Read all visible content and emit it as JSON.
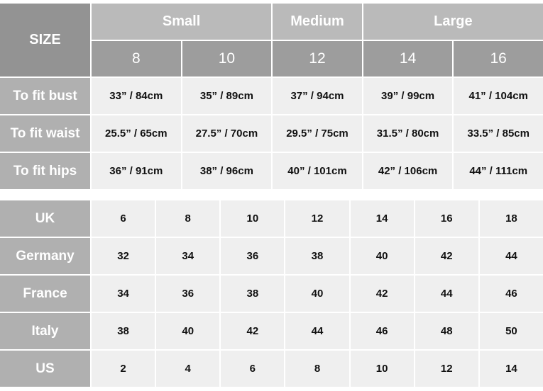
{
  "measurements": {
    "corner": "SIZE",
    "groups": [
      {
        "label": "Small",
        "span": 2
      },
      {
        "label": "Medium",
        "span": 1
      },
      {
        "label": "Large",
        "span": 2
      }
    ],
    "sizes": [
      "8",
      "10",
      "12",
      "14",
      "16"
    ],
    "rows": [
      {
        "label": "To fit bust",
        "values": [
          "33” / 84cm",
          "35” / 89cm",
          "37” / 94cm",
          "39” / 99cm",
          "41” / 104cm"
        ]
      },
      {
        "label": "To fit waist",
        "values": [
          "25.5” / 65cm",
          "27.5” / 70cm",
          "29.5” / 75cm",
          "31.5” / 80cm",
          "33.5” / 85cm"
        ]
      },
      {
        "label": "To fit hips",
        "values": [
          "36” / 91cm",
          "38” / 96cm",
          "40” / 101cm",
          "42” / 106cm",
          "44” / 111cm"
        ]
      }
    ]
  },
  "conversions": {
    "rows": [
      {
        "label": "UK",
        "values": [
          "6",
          "8",
          "10",
          "12",
          "14",
          "16",
          "18"
        ]
      },
      {
        "label": "Germany",
        "values": [
          "32",
          "34",
          "36",
          "38",
          "40",
          "42",
          "44"
        ]
      },
      {
        "label": "France",
        "values": [
          "34",
          "36",
          "38",
          "40",
          "42",
          "44",
          "46"
        ]
      },
      {
        "label": "Italy",
        "values": [
          "38",
          "40",
          "42",
          "44",
          "46",
          "48",
          "50"
        ]
      },
      {
        "label": "US",
        "values": [
          "2",
          "4",
          "6",
          "8",
          "10",
          "12",
          "14"
        ]
      }
    ]
  },
  "colors": {
    "corner": "#939393",
    "group_header": "#bababa",
    "size_header": "#9d9d9d",
    "row_label": "#b0b0b0",
    "cell": "#efefef"
  }
}
